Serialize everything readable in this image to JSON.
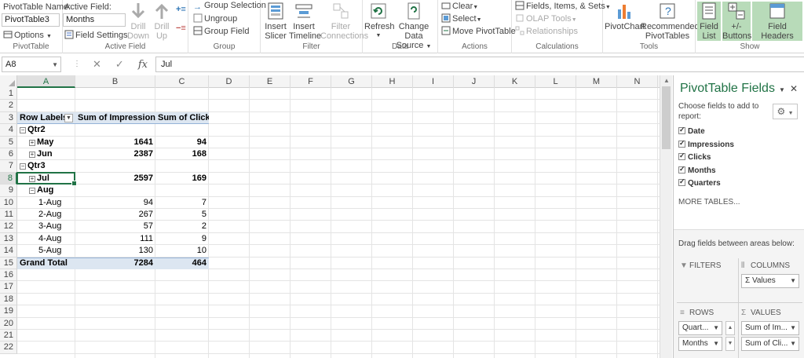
{
  "ribbon": {
    "pivottable": {
      "name_label": "PivotTable Name:",
      "name_value": "PivotTable3",
      "options_label": "Options",
      "group_label": "PivotTable"
    },
    "active_field": {
      "label": "Active Field:",
      "value": "Months",
      "field_settings": "Field Settings",
      "drill_down": [
        "Drill",
        "Down"
      ],
      "drill_up": [
        "Drill",
        "Up"
      ],
      "group_label": "Active Field"
    },
    "group": {
      "group_selection": "Group Selection",
      "ungroup": "Ungroup",
      "group_field": "Group Field",
      "group_label": "Group"
    },
    "filter": {
      "insert_slicer": [
        "Insert",
        "Slicer"
      ],
      "insert_timeline": [
        "Insert",
        "Timeline"
      ],
      "filter_connections": [
        "Filter",
        "Connections"
      ],
      "group_label": "Filter"
    },
    "data": {
      "refresh": "Refresh",
      "change_data_source": [
        "Change Data",
        "Source"
      ],
      "group_label": "Data"
    },
    "actions": {
      "clear": "Clear",
      "select": "Select",
      "move_pivottable": "Move PivotTable",
      "group_label": "Actions"
    },
    "calculations": {
      "fields_items_sets": "Fields, Items, & Sets",
      "olap_tools": "OLAP Tools",
      "relationships": "Relationships",
      "group_label": "Calculations"
    },
    "tools": {
      "pivotchart": "PivotChart",
      "recommended": [
        "Recommended",
        "PivotTables"
      ],
      "group_label": "Tools"
    },
    "show": {
      "field_list": [
        "Field",
        "List"
      ],
      "plus_minus": [
        "+/-",
        "Buttons"
      ],
      "field_headers": [
        "Field",
        "Headers"
      ],
      "group_label": "Show"
    }
  },
  "formula_bar": {
    "name_box": "A8",
    "formula": "Jul"
  },
  "columns": [
    "A",
    "B",
    "C",
    "D",
    "E",
    "F",
    "G",
    "H",
    "I",
    "J",
    "K",
    "L",
    "M",
    "N"
  ],
  "rows": [
    "1",
    "2",
    "3",
    "4",
    "5",
    "6",
    "7",
    "8",
    "9",
    "10",
    "11",
    "12",
    "13",
    "14",
    "15",
    "16",
    "17",
    "18",
    "19",
    "20",
    "21",
    "22"
  ],
  "pivot": {
    "headers": [
      "Row Labels",
      "Sum of Impressions",
      "Sum of Clicks"
    ],
    "rows": [
      {
        "label": "Qtr2",
        "impressions": "",
        "clicks": ""
      },
      {
        "label": "May",
        "impressions": "1641",
        "clicks": "94"
      },
      {
        "label": "Jun",
        "impressions": "2387",
        "clicks": "168"
      },
      {
        "label": "Qtr3",
        "impressions": "",
        "clicks": ""
      },
      {
        "label": "Jul",
        "impressions": "2597",
        "clicks": "169"
      },
      {
        "label": "Aug",
        "impressions": "",
        "clicks": ""
      },
      {
        "label": "1-Aug",
        "impressions": "94",
        "clicks": "7"
      },
      {
        "label": "2-Aug",
        "impressions": "267",
        "clicks": "5"
      },
      {
        "label": "3-Aug",
        "impressions": "57",
        "clicks": "2"
      },
      {
        "label": "4-Aug",
        "impressions": "111",
        "clicks": "9"
      },
      {
        "label": "5-Aug",
        "impressions": "130",
        "clicks": "10"
      },
      {
        "label": "Grand Total",
        "impressions": "7284",
        "clicks": "464"
      }
    ]
  },
  "panel": {
    "title": "PivotTable Fields",
    "choose_text": "Choose fields to add to report:",
    "fields": [
      "Date",
      "Impressions",
      "Clicks",
      "Months",
      "Quarters"
    ],
    "more_tables": "MORE TABLES...",
    "drag_text": "Drag fields between areas below:",
    "areas": {
      "filters": "FILTERS",
      "columns": "COLUMNS",
      "rows": "ROWS",
      "values": "VALUES"
    },
    "columns_items": [
      "Σ Values"
    ],
    "rows_items": [
      "Quart...",
      "Months"
    ],
    "values_items": [
      "Sum of Im...",
      "Sum of Cli..."
    ]
  }
}
